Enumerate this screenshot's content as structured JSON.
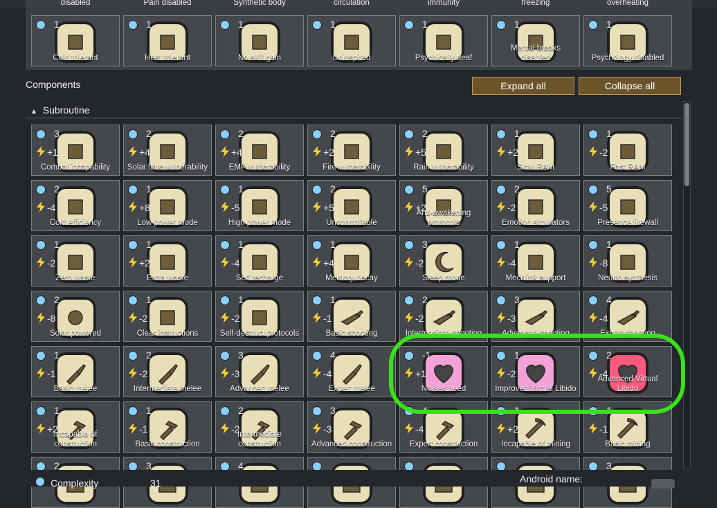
{
  "colors": {
    "accent": "#c59b4c",
    "complexity_blue": "#8ad0ff",
    "power_yellow": "#ffd23b",
    "highlight_green": "#39e11a"
  },
  "top_row_labels": [
    "disabled",
    "Pain disabled",
    "Synthetic body",
    "circulation",
    "immunity",
    "freezing",
    "overheating"
  ],
  "top_cards": [
    {
      "complexity": "1",
      "name": "Cold tolerant",
      "icon": "thermometer-icon"
    },
    {
      "complexity": "1",
      "name": "Heat tolerant",
      "icon": "thermometer-icon"
    },
    {
      "complexity": "1",
      "name": "No skill gain",
      "icon": "no-skill-icon"
    },
    {
      "complexity": "1",
      "name": "Uninspired",
      "icon": "no-inspiration-icon"
    },
    {
      "complexity": "1",
      "name": "Psychically deaf",
      "icon": "psychic-icon"
    },
    {
      "complexity": "1",
      "name": "Mental breaks disabled",
      "icon": "mental-icon"
    },
    {
      "complexity": "1",
      "name": "Psychology disabled",
      "icon": "psychology-icon"
    }
  ],
  "components_label": "Components",
  "expand_all": "Expand all",
  "collapse_all": "Collapse all",
  "section_title": "Subroutine",
  "grid": [
    [
      {
        "complexity": "3",
        "power": "+12",
        "name": "Combat incapability",
        "icon": "combat-icon"
      },
      {
        "complexity": "2",
        "power": "+4",
        "name": "Solar flare vulnerability",
        "icon": "solar-flare-icon"
      },
      {
        "complexity": "2",
        "power": "+4",
        "name": "EMP vulnerability",
        "icon": "emp-icon"
      },
      {
        "complexity": "2",
        "power": "+2",
        "name": "Fire vulnerability",
        "icon": "fire-icon"
      },
      {
        "complexity": "2",
        "power": "+5",
        "name": "Rain vulnerability",
        "icon": "rain-icon"
      },
      {
        "complexity": "1",
        "power": "+2",
        "name": "Slow RAM",
        "icon": "ram-icon"
      },
      {
        "complexity": "1",
        "power": "-2",
        "name": "Fast RAM",
        "icon": "fast-ram-icon"
      }
    ],
    [
      {
        "complexity": "2",
        "power": "-4",
        "name": "Cold efficiency",
        "icon": "cold-efficiency-icon"
      },
      {
        "complexity": "1",
        "power": "+8",
        "name": "Low power mode",
        "icon": "battery-low-icon"
      },
      {
        "complexity": "1",
        "power": "-5",
        "name": "High power mode",
        "icon": "battery-high-icon"
      },
      {
        "complexity": "2",
        "power": "+5",
        "name": "Uncontrollable",
        "icon": "controller-icon"
      },
      {
        "complexity": "5",
        "power": "+2",
        "name": "Anti-awakening protocols",
        "icon": "protocol-icon"
      },
      {
        "complexity": "2",
        "power": "-2",
        "name": "Emotion simulators",
        "icon": "emotion-icon"
      },
      {
        "complexity": "5",
        "power": "-5",
        "name": "Presence firewall",
        "icon": "firewall-icon"
      }
    ],
    [
      {
        "complexity": "1",
        "power": "-2",
        "name": "Zero waste",
        "icon": "recycle-icon"
      },
      {
        "complexity": "1",
        "power": "+2",
        "name": "Extra waste",
        "icon": "trash-icon"
      },
      {
        "complexity": "1",
        "power": "-4",
        "name": "Self recharge",
        "icon": "recharge-icon"
      },
      {
        "complexity": "1",
        "power": "+4",
        "name": "Memory decay",
        "icon": "memory-icon"
      },
      {
        "complexity": "3",
        "power": "-2",
        "name": "Sleep mode",
        "icon": "moon-icon"
      },
      {
        "complexity": "1",
        "power": "-4",
        "name": "Mechlink support",
        "icon": "mechlink-icon"
      },
      {
        "complexity": "1",
        "power": "-8",
        "name": "Neutro synthesis",
        "icon": "neutro-icon"
      }
    ],
    [
      {
        "complexity": "2",
        "power": "-8",
        "name": "Solar powered",
        "icon": "sun-icon"
      },
      {
        "complexity": "1",
        "power": "-2",
        "name": "Clear instructions",
        "icon": "pointer-icon"
      },
      {
        "complexity": "1",
        "power": "-2",
        "name": "Self-destruct protocols",
        "icon": "skull-icon"
      },
      {
        "complexity": "1",
        "power": "-1",
        "name": "Basic shooting",
        "icon": "gun-icon"
      },
      {
        "complexity": "2",
        "power": "-2",
        "name": "Intermediate shooting",
        "icon": "gun-icon"
      },
      {
        "complexity": "3",
        "power": "-3",
        "name": "Advanced shooting",
        "icon": "gun-icon"
      },
      {
        "complexity": "4",
        "power": "-4",
        "name": "Expert shooting",
        "icon": "gun-icon"
      }
    ],
    [
      {
        "complexity": "1",
        "power": "-1",
        "name": "Basic melee",
        "icon": "sword-icon"
      },
      {
        "complexity": "2",
        "power": "-2",
        "name": "Intermediate melee",
        "icon": "sword-icon"
      },
      {
        "complexity": "3",
        "power": "-3",
        "name": "Advanced melee",
        "icon": "sword-icon"
      },
      {
        "complexity": "4",
        "power": "-4",
        "name": "Expert melee",
        "icon": "sword-icon"
      },
      {
        "complexity": "-1",
        "power": "+1",
        "name": "No sex need",
        "icon": "heart-icon"
      },
      {
        "complexity": "1",
        "power": "-2",
        "name": "Improved Virtual Libido",
        "icon": "heart-icon"
      },
      {
        "complexity": "2",
        "power": "-4",
        "name": "Advanced Virtual Libido",
        "icon": "heart-icon"
      }
    ],
    [
      {
        "complexity": "1",
        "power": "+2",
        "name": "Incapable of construction",
        "icon": "hammer-icon"
      },
      {
        "complexity": "1",
        "power": "-1",
        "name": "Basic construction",
        "icon": "hammer-icon"
      },
      {
        "complexity": "2",
        "power": "-2",
        "name": "Intermediate construction",
        "icon": "hammer-icon"
      },
      {
        "complexity": "3",
        "power": "-3",
        "name": "Advanced construction",
        "icon": "hammer-icon"
      },
      {
        "complexity": "4",
        "power": "-4",
        "name": "Expert construction",
        "icon": "hammer-icon"
      },
      {
        "complexity": "1",
        "power": "+2",
        "name": "Incapable of mining",
        "icon": "pickaxe-icon"
      },
      {
        "complexity": "1",
        "power": "-1",
        "name": "Basic mining",
        "icon": "pickaxe-icon"
      }
    ],
    [
      {
        "complexity": "2",
        "power": "",
        "name": "",
        "icon": "generic-icon"
      },
      {
        "complexity": "3",
        "power": "",
        "name": "",
        "icon": "generic-icon"
      },
      {
        "complexity": "4",
        "power": "",
        "name": "",
        "icon": "generic-icon"
      },
      {
        "complexity": "",
        "power": "",
        "name": "",
        "icon": "generic-icon"
      },
      {
        "complexity": "",
        "power": "",
        "name": "",
        "icon": "generic-icon"
      },
      {
        "complexity": "",
        "power": "",
        "name": "",
        "icon": "generic-icon"
      },
      {
        "complexity": "3",
        "power": "",
        "name": "",
        "icon": "generic-icon"
      }
    ]
  ],
  "footer": {
    "complexity_label": "Complexity",
    "complexity_value": "31",
    "android_name_label": "Android name:"
  }
}
